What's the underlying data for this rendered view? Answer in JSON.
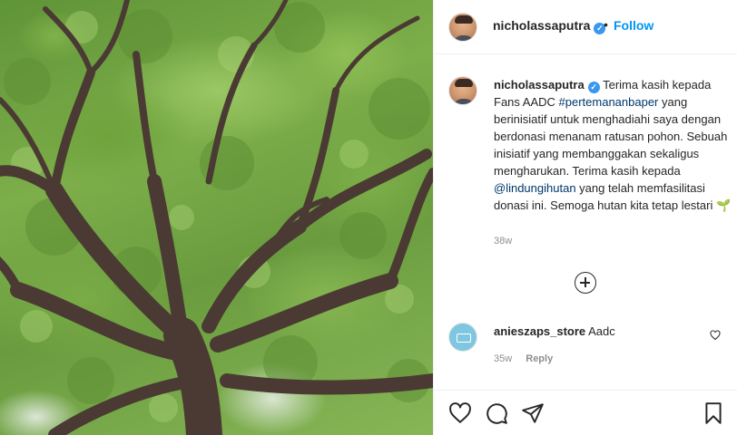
{
  "post": {
    "image_alt": "Tree canopy photo",
    "author": "nicholassaputra",
    "follow_label": "Follow",
    "separator": "•",
    "caption": {
      "username": "nicholassaputra",
      "part1": "Terima kasih kepada Fans AADC ",
      "hashtag": "#pertemananbaper",
      "part2": " yang berinisiatif untuk menghadiahi saya dengan berdonasi menanam ratusan pohon. Sebuah inisiatif yang membanggakan sekaligus mengharukan. Terima kasih kepada ",
      "mention": "@lindungihutan",
      "part3": " yang telah memfasilitasi donasi ini. Semoga hutan kita tetap lestari 🌱",
      "time": "38w"
    },
    "comments": [
      {
        "username": "anieszaps_store",
        "text": "Aadc",
        "time": "35w",
        "reply_label": "Reply"
      }
    ]
  },
  "icons": {
    "verified": "verified-badge-icon",
    "more": "load-more-comments-icon",
    "heart": "heart-icon",
    "comment": "comment-icon",
    "share": "share-icon",
    "save": "bookmark-icon"
  },
  "colors": {
    "accent": "#0095f6",
    "verified": "#3897f0",
    "text": "#262626",
    "muted": "#8e8e8e"
  }
}
